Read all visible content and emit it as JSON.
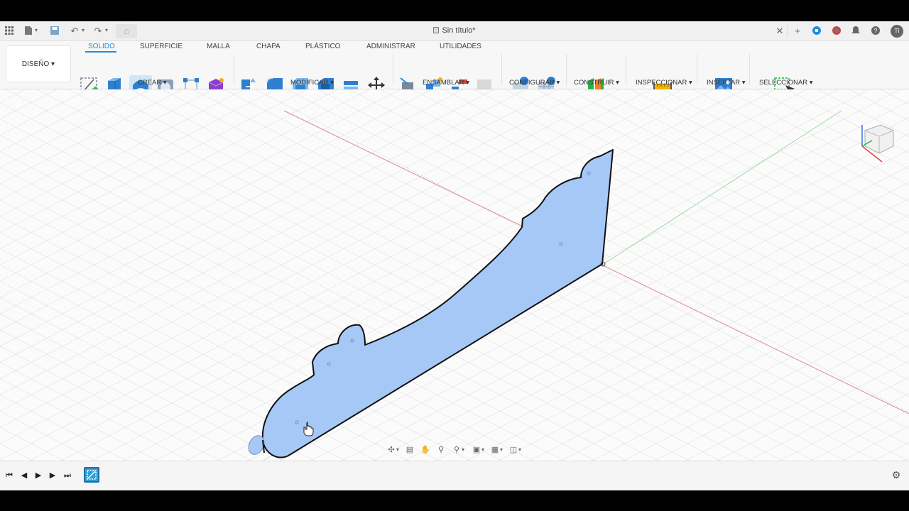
{
  "titlebar": {
    "doc_title": "Sin título*",
    "user_initials": "TI",
    "icons": [
      "apps-grid-icon",
      "file-menu-icon",
      "save-icon",
      "undo-icon",
      "redo-icon",
      "home-icon",
      "close-tab-icon",
      "new-tab-icon",
      "extensions-icon",
      "job-status-icon",
      "notifications-icon",
      "help-icon",
      "user-avatar"
    ]
  },
  "toolbar": {
    "workspace_label": "DISEÑO",
    "tabs": [
      {
        "label": "SOLIDO",
        "active": true
      },
      {
        "label": "SUPERFICIE"
      },
      {
        "label": "MALLA"
      },
      {
        "label": "CHAPA"
      },
      {
        "label": "PLÁSTICO"
      },
      {
        "label": "ADMINISTRAR"
      },
      {
        "label": "UTILIDADES"
      }
    ],
    "groups": [
      {
        "label": "CREAR ▾"
      },
      {
        "label": "MODIFICAR ▾"
      },
      {
        "label": "ENSAMBLAR ▾"
      },
      {
        "label": "CONFIGURAR ▾"
      },
      {
        "label": "CONSTRUIR ▾"
      },
      {
        "label": "INSPECCIONAR ▾"
      },
      {
        "label": "INSERTAR ▾"
      },
      {
        "label": "SELECCIONAR ▾"
      }
    ]
  },
  "colors": {
    "accent": "#1e8fd8",
    "profile_fill": "#a6c8f7",
    "grid_line": "#d8d8d8",
    "x_axis": "#e08a8a",
    "y_axis": "#9ed89e"
  },
  "viewcube": {
    "label": "view-cube-icon"
  },
  "timeline": {
    "controls": [
      "first-icon",
      "prev-icon",
      "play-icon",
      "next-icon",
      "last-icon"
    ],
    "settings": "gear-icon"
  }
}
